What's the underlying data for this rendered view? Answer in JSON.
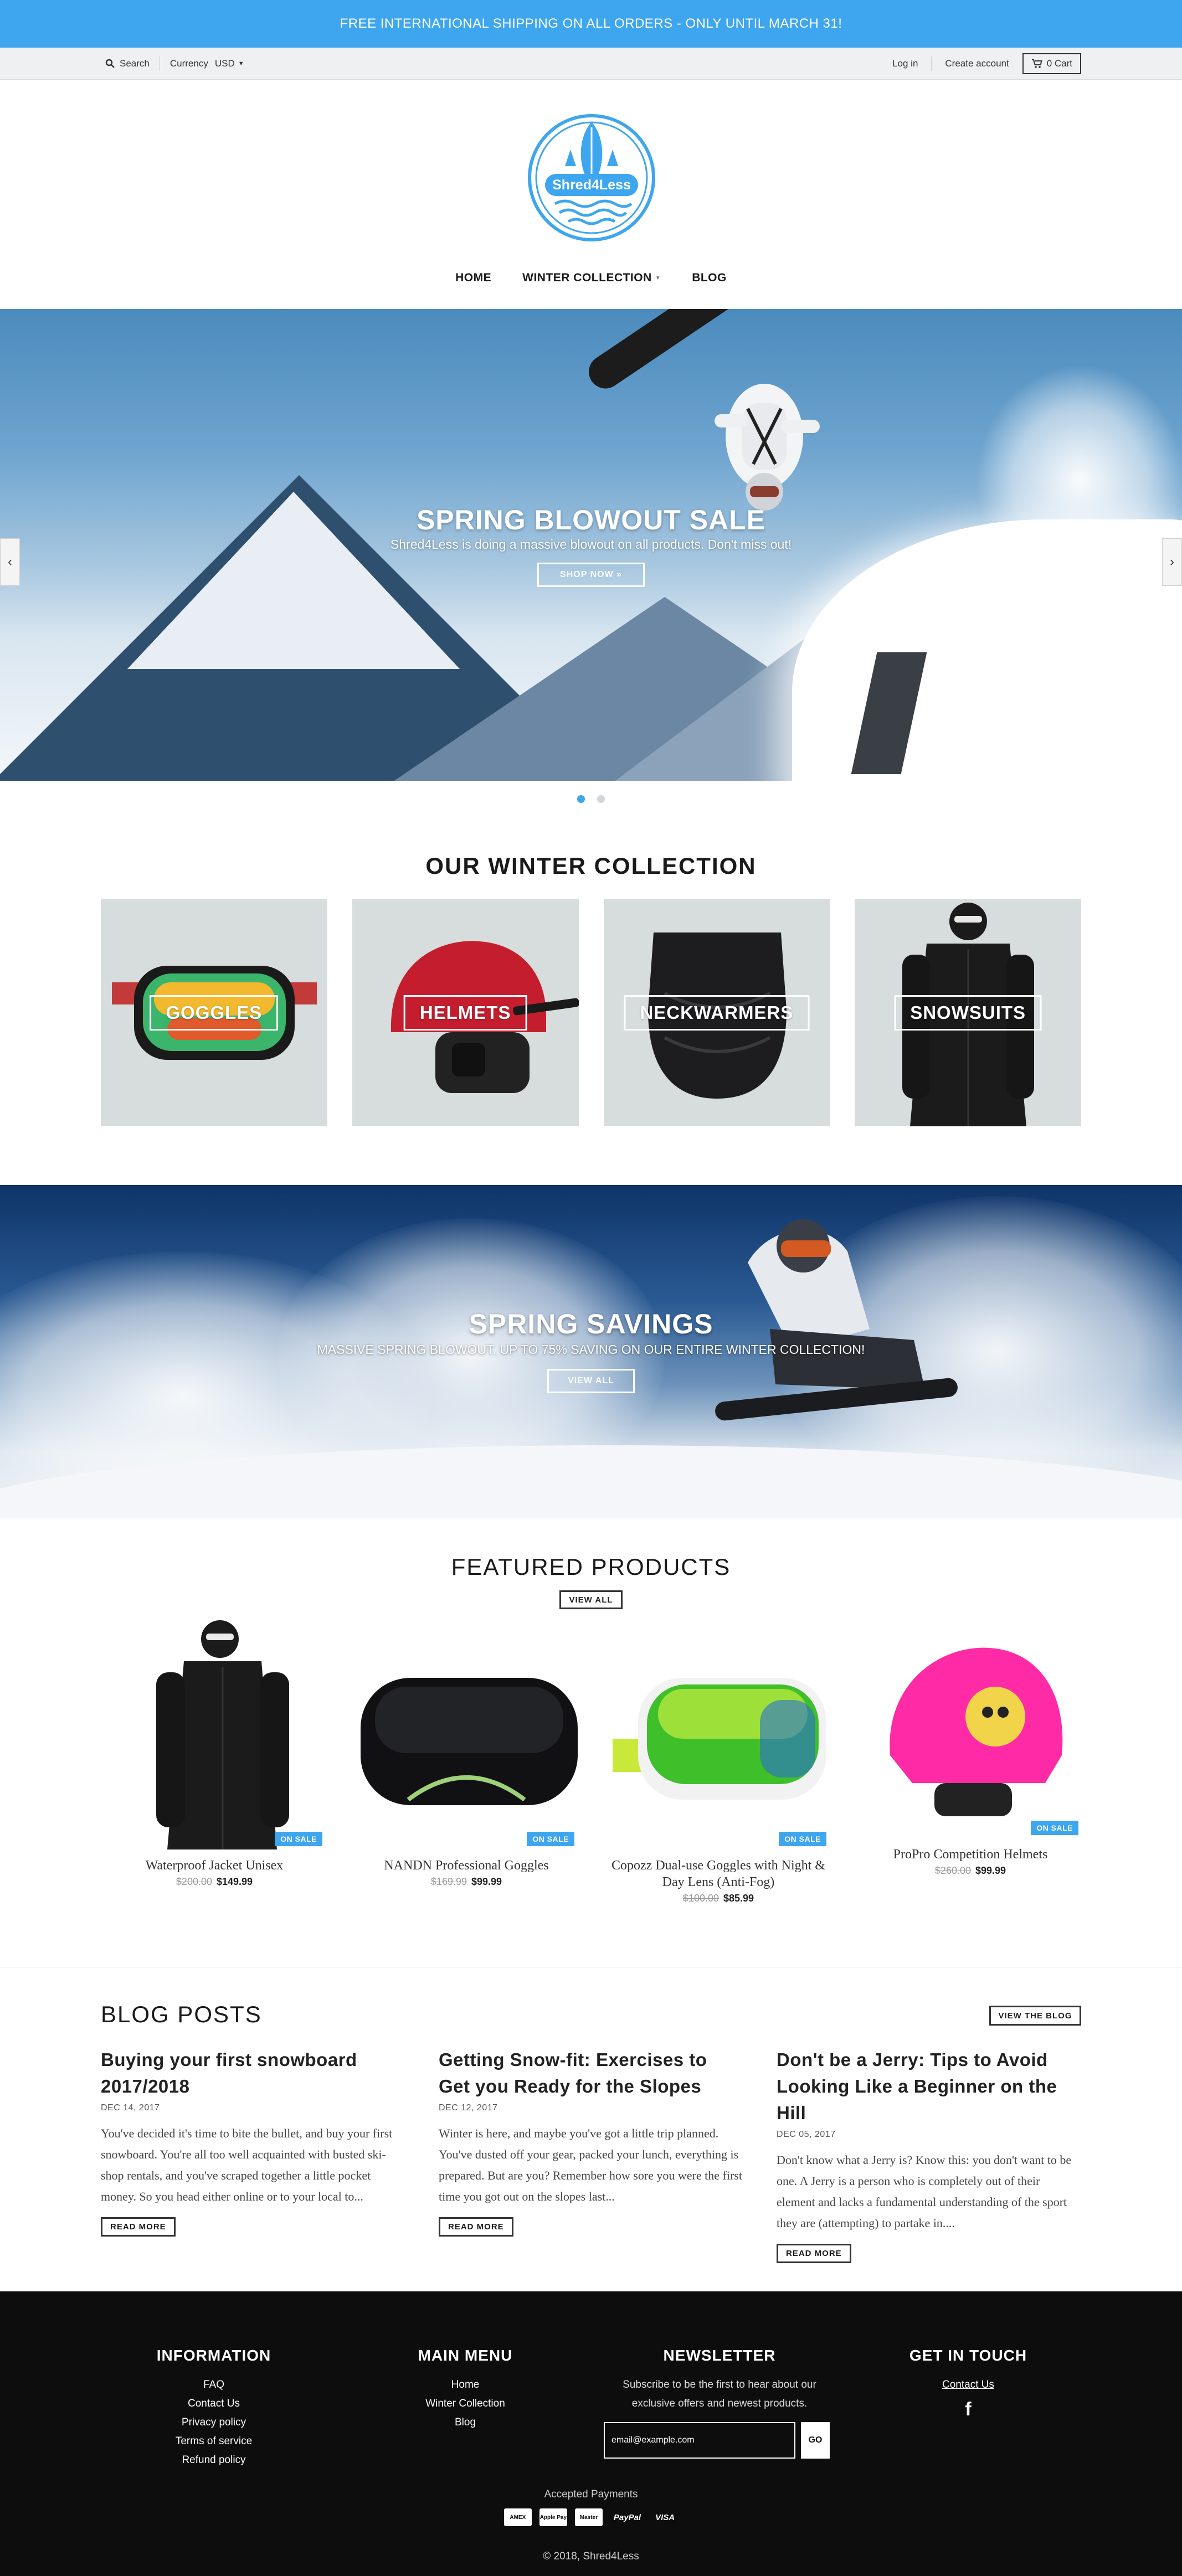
{
  "announcement": "FREE INTERNATIONAL SHIPPING ON ALL ORDERS - ONLY UNTIL MARCH 31!",
  "utility": {
    "search_label": "Search",
    "currency_label": "Currency",
    "currency_value": "USD",
    "login": "Log in",
    "create_account": "Create account",
    "cart": "0 Cart"
  },
  "logo": {
    "text": "Shred4Less"
  },
  "nav": {
    "home": "HOME",
    "winter": "WINTER COLLECTION",
    "blog": "BLOG"
  },
  "hero": {
    "title": "SPRING BLOWOUT SALE",
    "subtitle": "Shred4Less is doing a massive blowout on all products. Don't miss out!",
    "button": "SHOP NOW »"
  },
  "collection": {
    "title": "OUR WINTER COLLECTION",
    "items": [
      {
        "label": "GOGGLES"
      },
      {
        "label": "HELMETS"
      },
      {
        "label": "NECKWARMERS"
      },
      {
        "label": "SNOWSUITS"
      }
    ]
  },
  "savings": {
    "title": "SPRING SAVINGS",
    "subtitle": "MASSIVE SPRING BLOWOUT. UP TO 75% SAVING ON OUR ENTIRE WINTER COLLECTION!",
    "button": "VIEW ALL"
  },
  "featured": {
    "title": "FEATURED PRODUCTS",
    "view_all": "VIEW ALL",
    "products": [
      {
        "name": "Waterproof Jacket Unisex",
        "old_price": "$200.00",
        "price": "$149.99",
        "badge": "ON SALE"
      },
      {
        "name": "NANDN Professional Goggles",
        "old_price": "$169.99",
        "price": "$99.99",
        "badge": "ON SALE"
      },
      {
        "name": "Copozz Dual-use Goggles with Night & Day Lens (Anti-Fog)",
        "old_price": "$100.00",
        "price": "$85.99",
        "badge": "ON SALE"
      },
      {
        "name": "ProPro Competition Helmets",
        "old_price": "$260.00",
        "price": "$99.99",
        "badge": "ON SALE"
      }
    ]
  },
  "blog": {
    "title": "BLOG POSTS",
    "view_button": "VIEW THE BLOG",
    "posts": [
      {
        "title": "Buying your first snowboard 2017/2018",
        "date": "DEC 14, 2017",
        "excerpt": "You've decided it's time to bite the bullet, and buy your first snowboard. You're all too well acquainted with busted ski-shop rentals, and you've scraped together a little pocket money. So you head either online or to your local to...",
        "button": "READ MORE"
      },
      {
        "title": "Getting Snow-fit: Exercises to Get you Ready for the Slopes",
        "date": "DEC 12, 2017",
        "excerpt": "Winter is here, and maybe you've got a little trip planned. You've dusted off your gear, packed your lunch, everything is prepared. But are you? Remember how sore you were the first time you got out on the slopes last...",
        "button": "READ MORE"
      },
      {
        "title": "Don't be a Jerry: Tips to Avoid Looking Like a Beginner on the Hill",
        "date": "DEC 05, 2017",
        "excerpt": "Don't know what a Jerry is? Know this: you don't want to be one. A Jerry is a person who is completely out of their element and lacks a fundamental understanding of the sport they are (attempting) to partake in....",
        "button": "READ MORE"
      }
    ]
  },
  "footer": {
    "info": {
      "title": "INFORMATION",
      "links": [
        "FAQ",
        "Contact Us",
        "Privacy policy",
        "Terms of service",
        "Refund policy"
      ]
    },
    "menu": {
      "title": "MAIN MENU",
      "links": [
        "Home",
        "Winter Collection",
        "Blog"
      ]
    },
    "newsletter": {
      "title": "NEWSLETTER",
      "text": "Subscribe to be the first to hear about our exclusive offers and newest products.",
      "placeholder": "email@example.com",
      "button": "GO"
    },
    "contact": {
      "title": "GET IN TOUCH",
      "link": "Contact Us"
    },
    "payments_label": "Accepted Payments",
    "payments": [
      "AMEX",
      "Apple Pay",
      "Master",
      "PayPal",
      "VISA"
    ],
    "copyright": "© 2018, Shred4Less"
  },
  "colors": {
    "accent": "#3ea6ee",
    "footer_bg": "#0d0d0e",
    "sale_badge": "#3ea6ee"
  }
}
